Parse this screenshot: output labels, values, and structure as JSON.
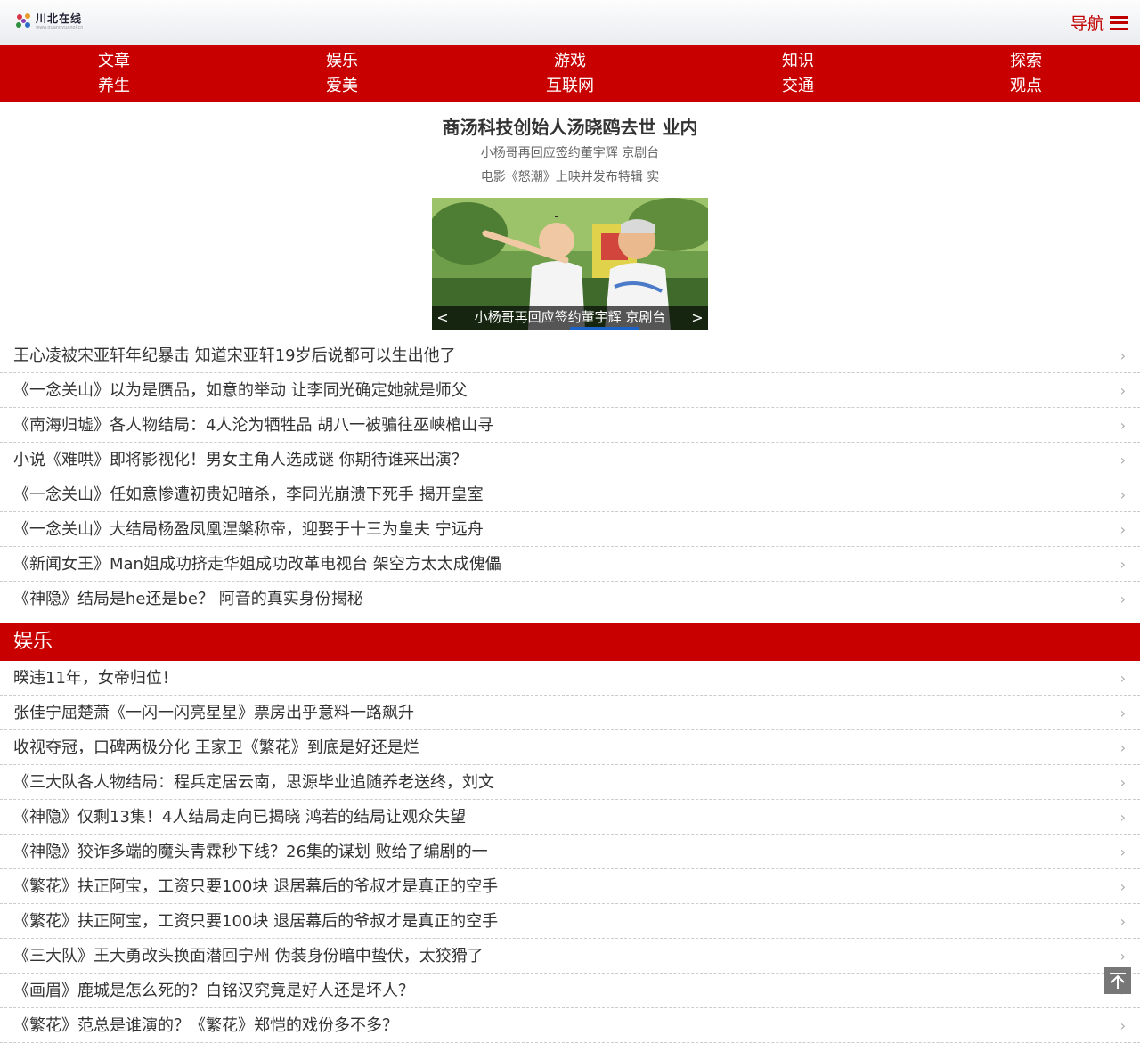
{
  "header": {
    "logo_name": "川北在线",
    "logo_url": "www.guangyuanol.cn",
    "nav_label": "导航"
  },
  "categories": [
    "文章",
    "娱乐",
    "游戏",
    "知识",
    "探索",
    "养生",
    "爱美",
    "互联网",
    "交通",
    "观点"
  ],
  "headline": {
    "title": "商汤科技创始人汤晓鸥去世 业内",
    "sub1": "小杨哥再回应签约董宇辉 京剧台",
    "sub2": "电影《怒潮》上映并发布特辑 实"
  },
  "slider": {
    "caption": "小杨哥再回应签约董宇辉 京剧台",
    "prev": "<",
    "next": ">"
  },
  "top_list": [
    "王心凌被宋亚轩年纪暴击 知道宋亚轩19岁后说都可以生出他了",
    "《一念关山》以为是赝品，如意的举动 让李同光确定她就是师父",
    "《南海归墟》各人物结局：4人沦为牺牲品 胡八一被骗往巫峡棺山寻",
    "小说《难哄》即将影视化！男女主角人选成谜 你期待谁来出演？",
    "《一念关山》任如意惨遭初贵妃暗杀，李同光崩溃下死手 揭开皇室",
    "《一念关山》大结局杨盈凤凰涅槃称帝，迎娶于十三为皇夫 宁远舟",
    "《新闻女王》Man姐成功挤走华姐成功改革电视台 架空方太太成傀儡",
    "《神隐》结局是he还是be？ 阿音的真实身份揭秘"
  ],
  "section": {
    "title": "娱乐"
  },
  "ent_list": [
    "暌违11年，女帝归位！",
    "张佳宁屈楚萧《一闪一闪亮星星》票房出乎意料一路飙升",
    "收视夺冠，口碑两极分化 王家卫《繁花》到底是好还是烂",
    "《三大队各人物结局：程兵定居云南，思源毕业追随养老送终，刘文",
    "《神隐》仅剩13集！4人结局走向已揭晓 鸿若的结局让观众失望",
    "《神隐》狡诈多端的魔头青霖秒下线？26集的谋划 败给了编剧的一",
    "《繁花》扶正阿宝，工资只要100块 退居幕后的爷叔才是真正的空手",
    "《繁花》扶正阿宝，工资只要100块 退居幕后的爷叔才是真正的空手",
    "《三大队》王大勇改头换面潜回宁州 伪装身份暗中蛰伏，太狡猾了",
    "《画眉》鹿城是怎么死的？白铭汉究竟是好人还是坏人？",
    "《繁花》范总是谁演的？《繁花》郑恺的戏份多不多？"
  ],
  "icons": {
    "chevron": "chevron-right-icon",
    "menu": "menu-icon",
    "back_to_top": "back-to-top-icon"
  },
  "colors": {
    "brand_red": "#c80000",
    "link_text": "#333333"
  }
}
